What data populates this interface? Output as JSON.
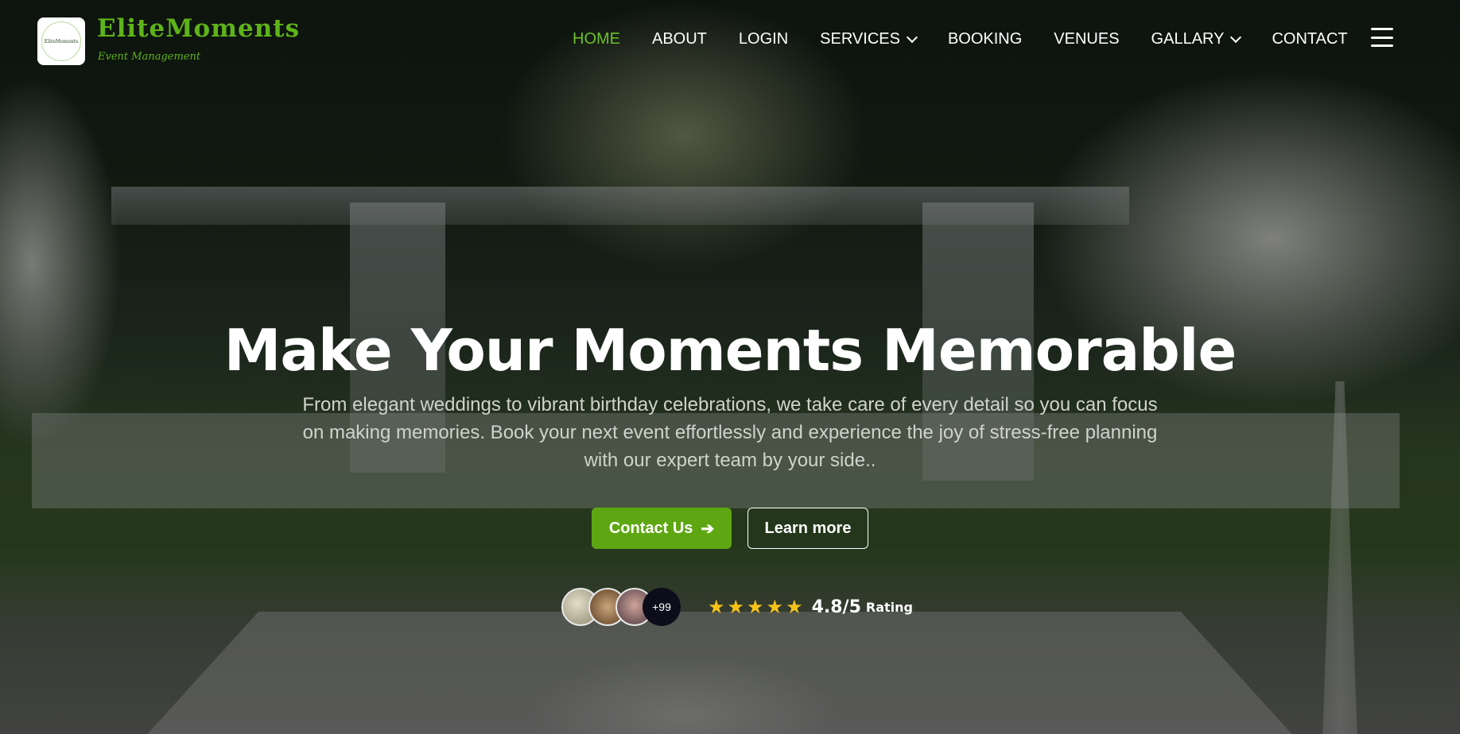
{
  "brand": {
    "logo_text": "EliteMoments",
    "title": "EliteMoments",
    "subtitle": "Event Management"
  },
  "nav": {
    "items": [
      {
        "label": "HOME",
        "active": true
      },
      {
        "label": "ABOUT"
      },
      {
        "label": "LOGIN"
      },
      {
        "label": "SERVICES",
        "dropdown": true
      },
      {
        "label": "BOOKING"
      },
      {
        "label": "VENUES"
      },
      {
        "label": "GALLARY",
        "dropdown": true
      },
      {
        "label": "CONTACT"
      }
    ],
    "menu_icon": "hamburger-menu-icon"
  },
  "hero": {
    "heading": "Make Your Moments Memorable",
    "description": "From elegant weddings to vibrant birthday celebrations, we take care of every detail so you can focus on making memories. Book your next event effortlessly and experience the joy of stress-free planning with our expert team by your side..",
    "primary_button": "Contact Us",
    "primary_button_icon": "arrow-right-icon",
    "secondary_button": "Learn more"
  },
  "social_proof": {
    "avatar_count_label": "+99",
    "stars": 5,
    "rating": "4.8/5",
    "rating_label": "Rating"
  },
  "colors": {
    "accent": "#5ea712",
    "active_nav": "#6cc02a",
    "star": "#f6c21a"
  }
}
